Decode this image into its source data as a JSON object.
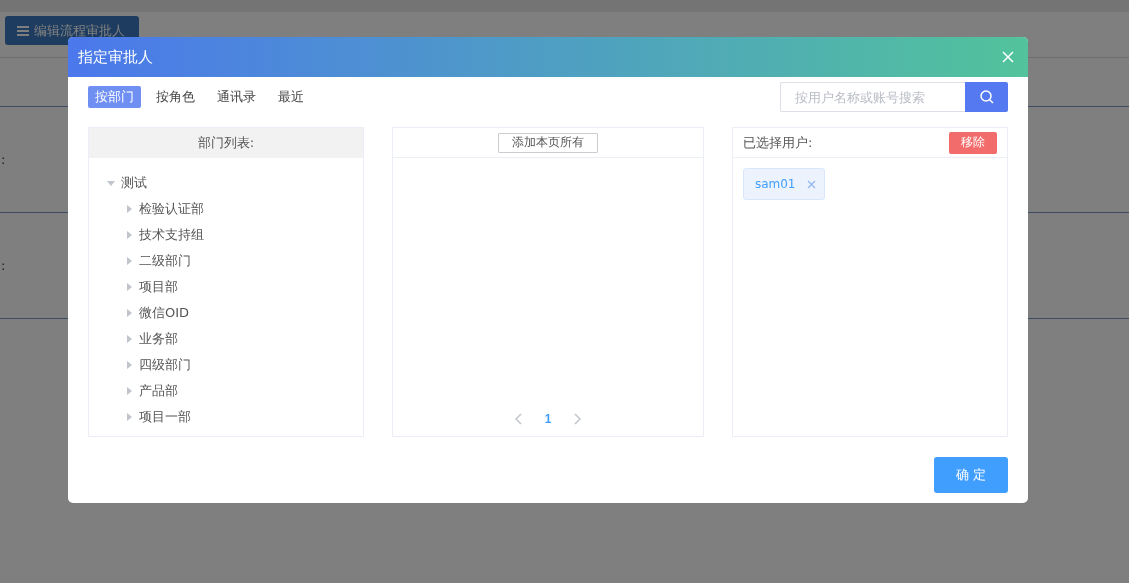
{
  "page": {
    "edit_button": "编辑流程审批人",
    "field_labels": [
      ":",
      ":"
    ]
  },
  "dialog": {
    "title": "指定审批人",
    "tabs": [
      {
        "label": "按部门",
        "selected": true
      },
      {
        "label": "按角色",
        "selected": false
      },
      {
        "label": "通讯录",
        "selected": false
      },
      {
        "label": "最近",
        "selected": false
      }
    ],
    "search": {
      "placeholder": "按用户名称或账号搜索"
    },
    "department_panel": {
      "header": "部门列表:",
      "tree": [
        {
          "label": "测试",
          "expanded": true,
          "children": [
            {
              "label": "检验认证部",
              "expanded": false
            },
            {
              "label": "技术支持组",
              "expanded": false
            },
            {
              "label": "二级部门",
              "expanded": false
            },
            {
              "label": "项目部",
              "expanded": false
            },
            {
              "label": "微信OID",
              "expanded": false
            },
            {
              "label": "业务部",
              "expanded": false
            },
            {
              "label": "四级部门",
              "expanded": false
            },
            {
              "label": "产品部",
              "expanded": false
            },
            {
              "label": "项目一部",
              "expanded": false
            }
          ]
        }
      ]
    },
    "user_panel": {
      "add_all_button": "添加本页所有",
      "pages": [
        {
          "label": "1",
          "selected": true
        }
      ]
    },
    "selected_panel": {
      "header": "已选择用户:",
      "remove_button": "移除",
      "users": [
        "sam01"
      ]
    },
    "confirm_button": "确 定"
  }
}
